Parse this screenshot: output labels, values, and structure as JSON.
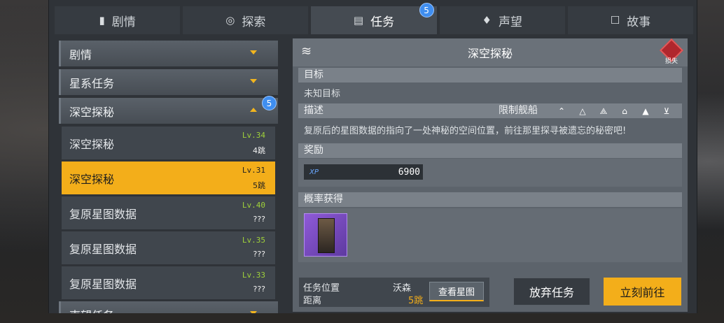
{
  "tabs": [
    {
      "label": "剧情",
      "icon": "book-icon",
      "glyph": "▮"
    },
    {
      "label": "探索",
      "icon": "explore-icon",
      "glyph": "◎"
    },
    {
      "label": "任务",
      "icon": "task-icon",
      "glyph": "▤",
      "badge": "5"
    },
    {
      "label": "声望",
      "icon": "reputation-icon",
      "glyph": "♦"
    },
    {
      "label": "故事",
      "icon": "story-icon",
      "glyph": "☐"
    }
  ],
  "left": {
    "categories": [
      {
        "label": "剧情"
      },
      {
        "label": "星系任务"
      },
      {
        "label": "深空探秘",
        "badge": "5"
      }
    ],
    "items": [
      {
        "name": "深空探秘",
        "level": "Lv.34",
        "jumps": "4跳"
      },
      {
        "name": "深空探秘",
        "level": "Lv.31",
        "jumps": "5跳"
      },
      {
        "name": "复原星图数据",
        "level": "Lv.40",
        "jumps": "???"
      },
      {
        "name": "复原星图数据",
        "level": "Lv.35",
        "jumps": "???"
      },
      {
        "name": "复原星图数据",
        "level": "Lv.33",
        "jumps": "???"
      }
    ],
    "last_category": "声望任务"
  },
  "detail": {
    "title": "深空探秘",
    "lost_label": "损失",
    "goal_label": "目标",
    "goal_text": "未知目标",
    "desc_label": "描述",
    "ship_limit_label": "限制舰船",
    "desc_text": "复原后的星图数据的指向了一处神秘的空间位置，前往那里探寻被遗忘的秘密吧!",
    "reward_label": "奖励",
    "xp_label": "XP",
    "xp_value": "6900",
    "drop_label": "概率获得"
  },
  "bottom": {
    "location_label": "任务位置",
    "location_value": "沃森",
    "distance_label": "距离",
    "distance_value": "5跳",
    "map_button": "查看星图",
    "abandon_button": "放弃任务",
    "goto_button": "立刻前往"
  },
  "colors": {
    "accent": "#f3ae1a",
    "badge": "#3f8ef0",
    "level": "#9fd13a"
  }
}
